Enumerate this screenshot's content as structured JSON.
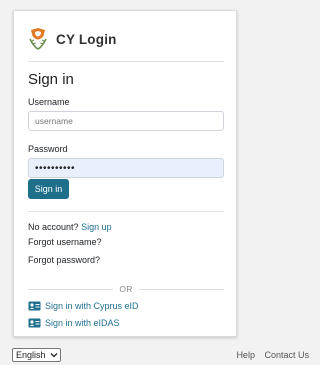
{
  "brand": {
    "title": "CY Login"
  },
  "login": {
    "heading": "Sign in",
    "username_label": "Username",
    "username_placeholder": "username",
    "password_label": "Password",
    "password_value": "••••••••••",
    "submit_label": "Sign in"
  },
  "links": {
    "no_account_text": "No account?",
    "sign_up": "Sign up",
    "forgot_username": "Forgot username?",
    "forgot_password": "Forgot password?",
    "or_text": "OR",
    "cyprus_eid": "Sign in with Cyprus eID",
    "eidas": "Sign in with eIDAS"
  },
  "footer": {
    "language": "English",
    "help": "Help",
    "contact": "Contact Us"
  },
  "colors": {
    "primary": "#1d6f8a",
    "link": "#1f6f8f",
    "autofill": "#e8f0fe",
    "logo_orange": "#e07b24"
  },
  "icons": {
    "logo": "cyprus-emblem-icon",
    "eid": "id-card-icon",
    "dropdown": "chevron-down-icon"
  }
}
